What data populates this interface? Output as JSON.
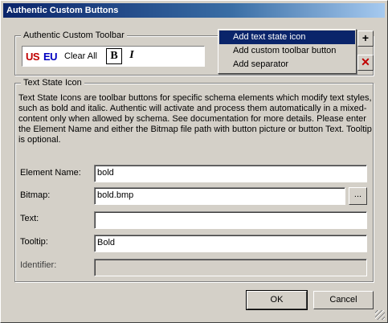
{
  "window": {
    "title": "Authentic Custom Buttons"
  },
  "toolbar_group": {
    "title": "Authentic Custom Toolbar",
    "items": {
      "us": "US",
      "eu": "EU",
      "clear_all": "Clear All",
      "bold": "B",
      "italic": "I"
    },
    "add_button": "+",
    "delete_button": "✕"
  },
  "menu": {
    "items": [
      {
        "label": "Add text state icon",
        "selected": true
      },
      {
        "label": "Add custom toolbar button",
        "selected": false
      },
      {
        "label": "Add separator",
        "selected": false
      }
    ]
  },
  "state_group": {
    "title": "Text State Icon",
    "description": "Text State Icons are toolbar buttons for specific schema elements which modify text styles, such as bold and italic. Authentic will activate and process them automatically in a mixed-content only when allowed by schema. See documentation for more details. Please enter the Element Name and either the Bitmap file path with button picture or button Text. Tooltip is optional.",
    "fields": {
      "element_name": {
        "label": "Element Name:",
        "value": "bold"
      },
      "bitmap": {
        "label": "Bitmap:",
        "value": "bold.bmp",
        "browse": "..."
      },
      "text": {
        "label": "Text:",
        "value": ""
      },
      "tooltip": {
        "label": "Tooltip:",
        "value": "Bold"
      },
      "identifier": {
        "label": "Identifier:",
        "value": ""
      }
    }
  },
  "buttons": {
    "ok": "OK",
    "cancel": "Cancel"
  }
}
